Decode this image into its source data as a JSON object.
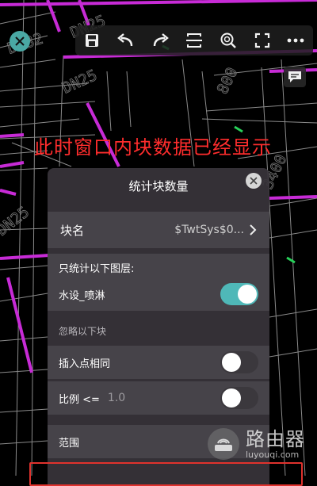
{
  "colors": {
    "accent": "#4fb8b8",
    "pipe": "#c72bd6",
    "caption": "#ff2d2d",
    "highlight": "#e0322d",
    "marker": "#28d25a"
  },
  "drawing": {
    "labels": [
      "DN32",
      "DN25",
      "DN25",
      "DN25",
      "800",
      "3400"
    ]
  },
  "toolbar": {
    "close_icon": "close-icon",
    "buttons": [
      "save-icon",
      "undo-icon",
      "redo-icon",
      "split-view-icon",
      "zoom-icon",
      "fullscreen-icon",
      "more-icon"
    ],
    "chat_icon": "comment-icon"
  },
  "caption": "此时窗口内块数据已经显示",
  "panel": {
    "title": "统计块数量",
    "block_name": {
      "label": "块名",
      "value": "$TwtSys$0..."
    },
    "layers": {
      "label": "只统计以下图层:",
      "layer_name": "水设_喷淋",
      "enabled": true
    },
    "ignore_section": "忽略以下块",
    "same_insertion": {
      "label": "插入点相同",
      "enabled": false
    },
    "scale": {
      "label": "比例 <=",
      "value": "1.0",
      "enabled": false
    },
    "range": {
      "label": "范围"
    }
  },
  "watermark": {
    "cn": "路由器",
    "en": "luyouqi.com"
  }
}
